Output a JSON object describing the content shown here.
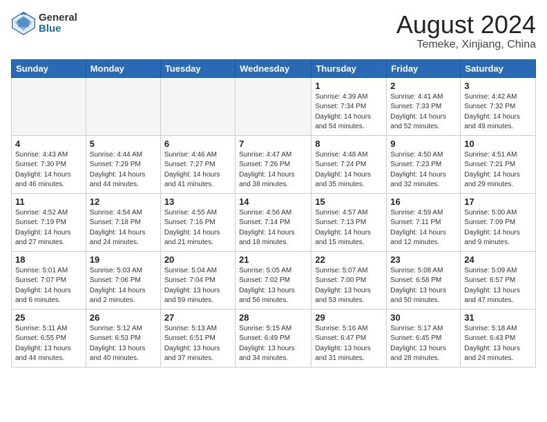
{
  "logo": {
    "general": "General",
    "blue": "Blue"
  },
  "title": {
    "month_year": "August 2024",
    "location": "Temeke, Xinjiang, China"
  },
  "weekdays": [
    "Sunday",
    "Monday",
    "Tuesday",
    "Wednesday",
    "Thursday",
    "Friday",
    "Saturday"
  ],
  "weeks": [
    [
      {
        "day": "",
        "info": ""
      },
      {
        "day": "",
        "info": ""
      },
      {
        "day": "",
        "info": ""
      },
      {
        "day": "",
        "info": ""
      },
      {
        "day": "1",
        "info": "Sunrise: 4:39 AM\nSunset: 7:34 PM\nDaylight: 14 hours\nand 54 minutes."
      },
      {
        "day": "2",
        "info": "Sunrise: 4:41 AM\nSunset: 7:33 PM\nDaylight: 14 hours\nand 52 minutes."
      },
      {
        "day": "3",
        "info": "Sunrise: 4:42 AM\nSunset: 7:32 PM\nDaylight: 14 hours\nand 49 minutes."
      }
    ],
    [
      {
        "day": "4",
        "info": "Sunrise: 4:43 AM\nSunset: 7:30 PM\nDaylight: 14 hours\nand 46 minutes."
      },
      {
        "day": "5",
        "info": "Sunrise: 4:44 AM\nSunset: 7:29 PM\nDaylight: 14 hours\nand 44 minutes."
      },
      {
        "day": "6",
        "info": "Sunrise: 4:46 AM\nSunset: 7:27 PM\nDaylight: 14 hours\nand 41 minutes."
      },
      {
        "day": "7",
        "info": "Sunrise: 4:47 AM\nSunset: 7:26 PM\nDaylight: 14 hours\nand 38 minutes."
      },
      {
        "day": "8",
        "info": "Sunrise: 4:48 AM\nSunset: 7:24 PM\nDaylight: 14 hours\nand 35 minutes."
      },
      {
        "day": "9",
        "info": "Sunrise: 4:50 AM\nSunset: 7:23 PM\nDaylight: 14 hours\nand 32 minutes."
      },
      {
        "day": "10",
        "info": "Sunrise: 4:51 AM\nSunset: 7:21 PM\nDaylight: 14 hours\nand 29 minutes."
      }
    ],
    [
      {
        "day": "11",
        "info": "Sunrise: 4:52 AM\nSunset: 7:19 PM\nDaylight: 14 hours\nand 27 minutes."
      },
      {
        "day": "12",
        "info": "Sunrise: 4:54 AM\nSunset: 7:18 PM\nDaylight: 14 hours\nand 24 minutes."
      },
      {
        "day": "13",
        "info": "Sunrise: 4:55 AM\nSunset: 7:16 PM\nDaylight: 14 hours\nand 21 minutes."
      },
      {
        "day": "14",
        "info": "Sunrise: 4:56 AM\nSunset: 7:14 PM\nDaylight: 14 hours\nand 18 minutes."
      },
      {
        "day": "15",
        "info": "Sunrise: 4:57 AM\nSunset: 7:13 PM\nDaylight: 14 hours\nand 15 minutes."
      },
      {
        "day": "16",
        "info": "Sunrise: 4:59 AM\nSunset: 7:11 PM\nDaylight: 14 hours\nand 12 minutes."
      },
      {
        "day": "17",
        "info": "Sunrise: 5:00 AM\nSunset: 7:09 PM\nDaylight: 14 hours\nand 9 minutes."
      }
    ],
    [
      {
        "day": "18",
        "info": "Sunrise: 5:01 AM\nSunset: 7:07 PM\nDaylight: 14 hours\nand 6 minutes."
      },
      {
        "day": "19",
        "info": "Sunrise: 5:03 AM\nSunset: 7:06 PM\nDaylight: 14 hours\nand 2 minutes."
      },
      {
        "day": "20",
        "info": "Sunrise: 5:04 AM\nSunset: 7:04 PM\nDaylight: 13 hours\nand 59 minutes."
      },
      {
        "day": "21",
        "info": "Sunrise: 5:05 AM\nSunset: 7:02 PM\nDaylight: 13 hours\nand 56 minutes."
      },
      {
        "day": "22",
        "info": "Sunrise: 5:07 AM\nSunset: 7:00 PM\nDaylight: 13 hours\nand 53 minutes."
      },
      {
        "day": "23",
        "info": "Sunrise: 5:08 AM\nSunset: 6:58 PM\nDaylight: 13 hours\nand 50 minutes."
      },
      {
        "day": "24",
        "info": "Sunrise: 5:09 AM\nSunset: 6:57 PM\nDaylight: 13 hours\nand 47 minutes."
      }
    ],
    [
      {
        "day": "25",
        "info": "Sunrise: 5:11 AM\nSunset: 6:55 PM\nDaylight: 13 hours\nand 44 minutes."
      },
      {
        "day": "26",
        "info": "Sunrise: 5:12 AM\nSunset: 6:53 PM\nDaylight: 13 hours\nand 40 minutes."
      },
      {
        "day": "27",
        "info": "Sunrise: 5:13 AM\nSunset: 6:51 PM\nDaylight: 13 hours\nand 37 minutes."
      },
      {
        "day": "28",
        "info": "Sunrise: 5:15 AM\nSunset: 6:49 PM\nDaylight: 13 hours\nand 34 minutes."
      },
      {
        "day": "29",
        "info": "Sunrise: 5:16 AM\nSunset: 6:47 PM\nDaylight: 13 hours\nand 31 minutes."
      },
      {
        "day": "30",
        "info": "Sunrise: 5:17 AM\nSunset: 6:45 PM\nDaylight: 13 hours\nand 28 minutes."
      },
      {
        "day": "31",
        "info": "Sunrise: 5:18 AM\nSunset: 6:43 PM\nDaylight: 13 hours\nand 24 minutes."
      }
    ]
  ]
}
